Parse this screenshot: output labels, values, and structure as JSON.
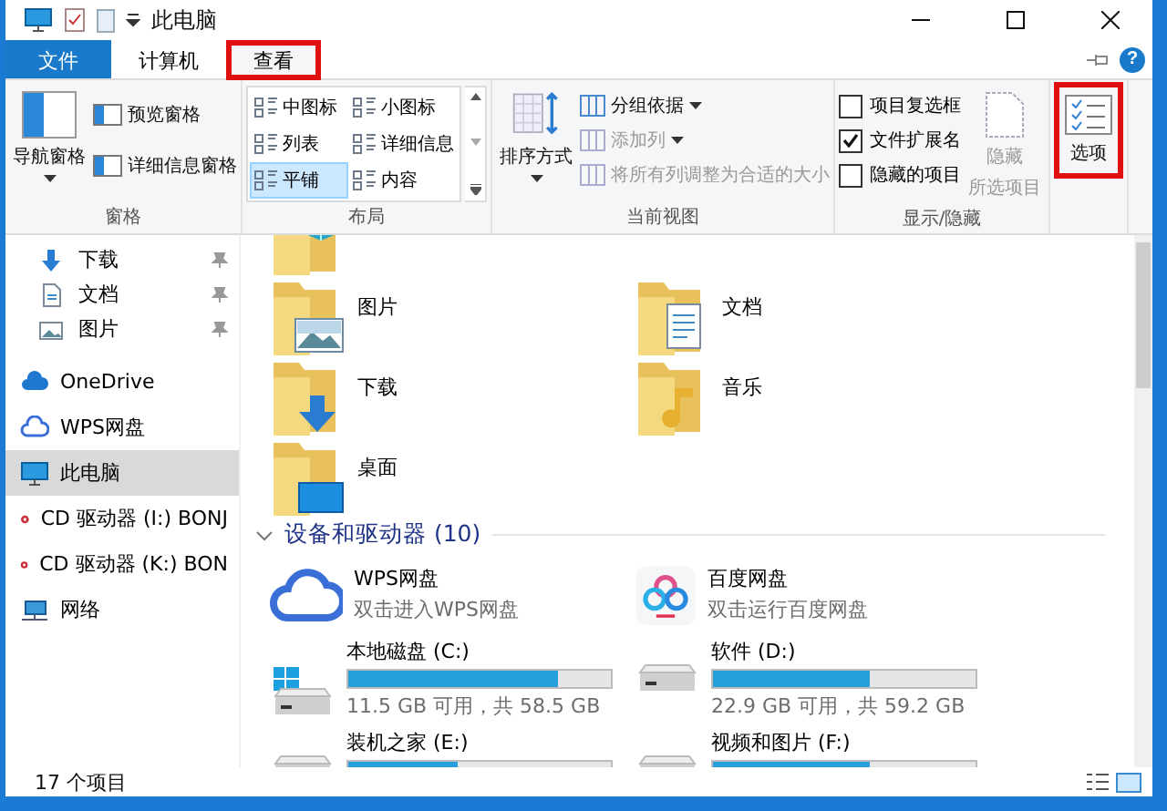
{
  "window": {
    "title": "此电脑"
  },
  "tabs": [
    {
      "label": "文件",
      "kind": "file",
      "selected": false,
      "highlighted": false
    },
    {
      "label": "计算机",
      "kind": "tab",
      "selected": false,
      "highlighted": false
    },
    {
      "label": "查看",
      "kind": "tab",
      "selected": true,
      "highlighted": true
    }
  ],
  "help": {
    "label": "?"
  },
  "ribbon": {
    "groups": [
      {
        "label": "窗格",
        "kind": "panes",
        "big": {
          "label": "导航窗格",
          "disabled": false
        },
        "items": [
          {
            "label": "预览窗格",
            "disabled": false
          },
          {
            "label": "详细信息窗格",
            "disabled": false
          }
        ]
      },
      {
        "label": "布局",
        "kind": "layout",
        "items": [
          {
            "label": "中图标",
            "selected": false
          },
          {
            "label": "小图标",
            "selected": false
          },
          {
            "label": "列表",
            "selected": false
          },
          {
            "label": "详细信息",
            "selected": false
          },
          {
            "label": "平铺",
            "selected": true
          },
          {
            "label": "内容",
            "selected": false
          }
        ]
      },
      {
        "label": "当前视图",
        "kind": "view",
        "big": {
          "label": "排序方式",
          "disabled": false
        },
        "items": [
          {
            "label": "分组依据",
            "disabled": false
          },
          {
            "label": "添加列",
            "disabled": true
          },
          {
            "label": "将所有列调整为合适的大小",
            "disabled": true
          }
        ]
      },
      {
        "label": "显示/隐藏",
        "kind": "show",
        "checks": [
          {
            "label": "项目复选框",
            "checked": false
          },
          {
            "label": "文件扩展名",
            "checked": true
          },
          {
            "label": "隐藏的项目",
            "checked": false
          }
        ],
        "big": {
          "label_lines": [
            "隐藏",
            "所选项目"
          ],
          "disabled": true
        }
      },
      {
        "kind": "options",
        "big": {
          "label": "选项",
          "disabled": false,
          "highlighted": true
        }
      }
    ]
  },
  "sidebar": {
    "items": [
      {
        "label": "下载",
        "pinned": true,
        "selected": false
      },
      {
        "label": "文档",
        "pinned": true,
        "selected": false
      },
      {
        "label": "图片",
        "pinned": true,
        "selected": false
      },
      {
        "label": "OneDrive",
        "pinned": false,
        "selected": false
      },
      {
        "label": "WPS网盘",
        "pinned": false,
        "selected": false
      },
      {
        "label": "此电脑",
        "pinned": false,
        "selected": true
      },
      {
        "label": "CD 驱动器 (I:) BONJ",
        "pinned": false,
        "selected": false
      },
      {
        "label": "CD 驱动器 (K:) BON",
        "pinned": false,
        "selected": false
      },
      {
        "label": "网络",
        "pinned": false,
        "selected": false
      }
    ]
  },
  "folders": [
    {
      "name": "图片"
    },
    {
      "name": "文档"
    },
    {
      "name": "下载"
    },
    {
      "name": "音乐"
    },
    {
      "name": "桌面"
    }
  ],
  "devices": {
    "header": "设备和驱动器 (10)",
    "items": [
      {
        "kind": "cloud",
        "name": "WPS网盘",
        "subtitle": "双击进入WPS网盘"
      },
      {
        "kind": "cloud",
        "name": "百度网盘",
        "subtitle": "双击运行百度网盘"
      },
      {
        "kind": "drive",
        "name": "本地磁盘 (C:)",
        "level": 0.8,
        "free": "11.5 GB 可用，共 58.5 GB"
      },
      {
        "kind": "drive",
        "name": "软件 (D:)",
        "level": 0.6,
        "free": "22.9 GB 可用，共 59.2 GB"
      },
      {
        "kind": "drive",
        "name": "装机之家 (E:)",
        "level": 0.42
      },
      {
        "kind": "drive",
        "name": "视频和图片 (F:)",
        "level": 0.6
      }
    ]
  },
  "status_bar": {
    "count": "17 个项目"
  }
}
